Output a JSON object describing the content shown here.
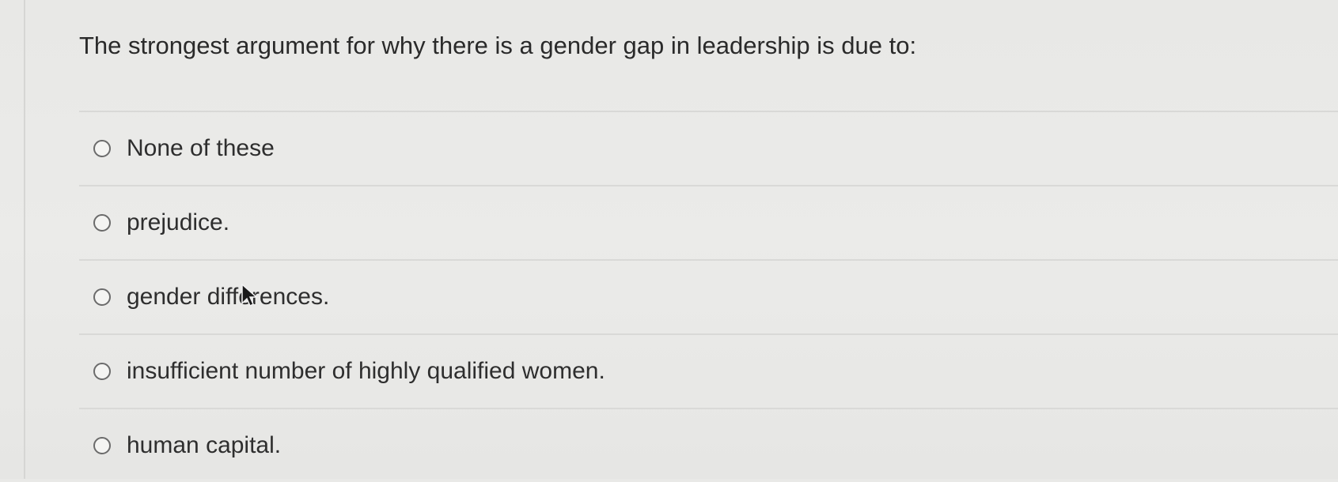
{
  "question": {
    "text": "The strongest argument for why there is a gender gap in leadership is due to:"
  },
  "options": [
    {
      "label": "None of these",
      "selected": false
    },
    {
      "label": "prejudice.",
      "selected": false
    },
    {
      "label": "gender differences.",
      "selected": false
    },
    {
      "label": "insufficient number of highly qualified women.",
      "selected": false
    },
    {
      "label": "human capital.",
      "selected": false
    }
  ],
  "icons": {
    "cursor": "mouse-pointer-icon",
    "radio": "radio-button-icon"
  },
  "colors": {
    "background": "#e9e9e7",
    "text": "#2f2f2f",
    "divider": "#d9d9d7",
    "radio_border": "#6b6b6b"
  }
}
